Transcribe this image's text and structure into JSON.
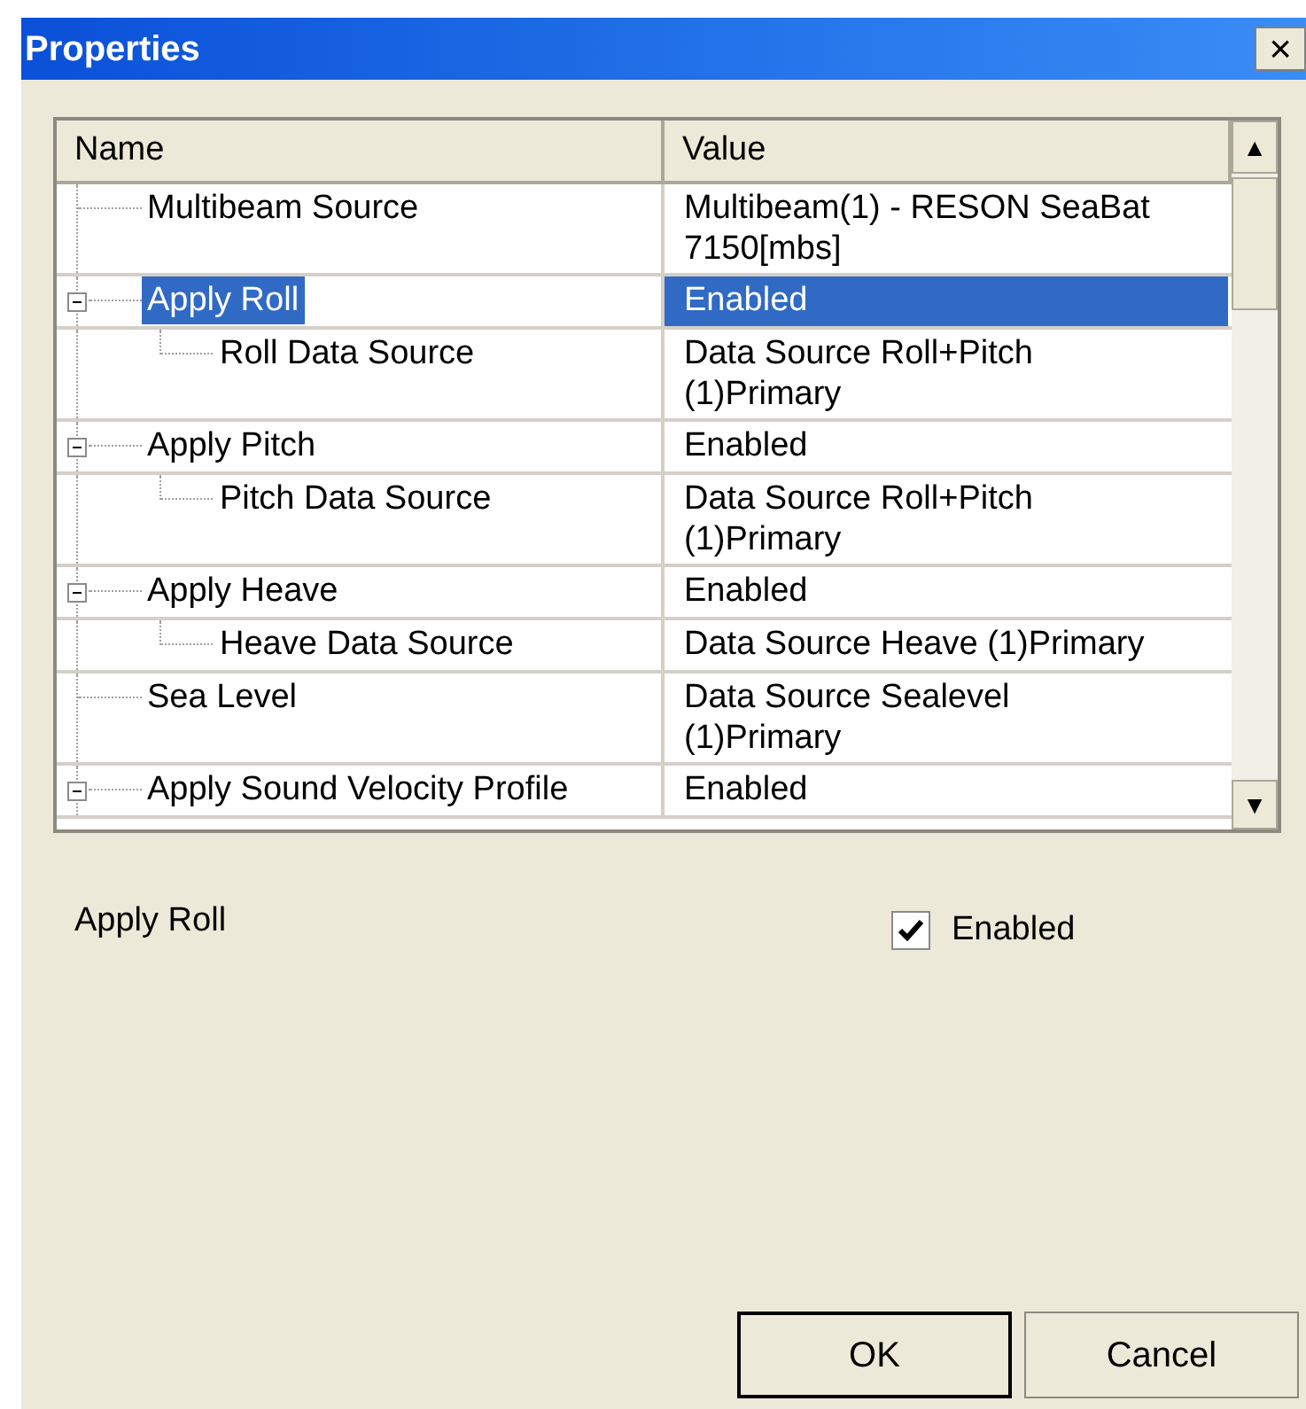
{
  "window": {
    "title": "Properties",
    "close": "×"
  },
  "table": {
    "columns": [
      "Name",
      "Value"
    ],
    "up_arrow": "▲",
    "down_arrow": "▼",
    "properties": [
      {
        "name": "Multibeam Source",
        "value": "Multibeam(1) - RESON SeaBat 7150[mbs]",
        "selected": false
      },
      {
        "name": "Apply Roll",
        "value": "Enabled",
        "selected": true,
        "expanded": true,
        "children": [
          {
            "name": "Roll Data Source",
            "value": "Data Source Roll+Pitch (1)Primary",
            "selected": false
          }
        ]
      },
      {
        "name": "Apply Pitch",
        "value": "Enabled",
        "selected": false,
        "expanded": true,
        "children": [
          {
            "name": "Pitch Data Source",
            "value": "Data Source Roll+Pitch (1)Primary",
            "selected": false
          }
        ]
      },
      {
        "name": "Apply Heave",
        "value": "Enabled",
        "selected": false,
        "expanded": true,
        "children": [
          {
            "name": "Heave Data Source",
            "value": "Data Source Heave (1)Primary",
            "selected": false
          }
        ]
      },
      {
        "name": "Sea Level",
        "value": "Data Source Sealevel (1)Primary",
        "selected": false
      },
      {
        "name": "Apply Sound Velocity Profile",
        "value": "Enabled",
        "selected": false,
        "expanded": true
      }
    ]
  },
  "editor": {
    "label": "Apply Roll",
    "checkbox": {
      "label": "Enabled",
      "checked": true
    }
  },
  "buttons": [
    "OK",
    "Cancel"
  ]
}
